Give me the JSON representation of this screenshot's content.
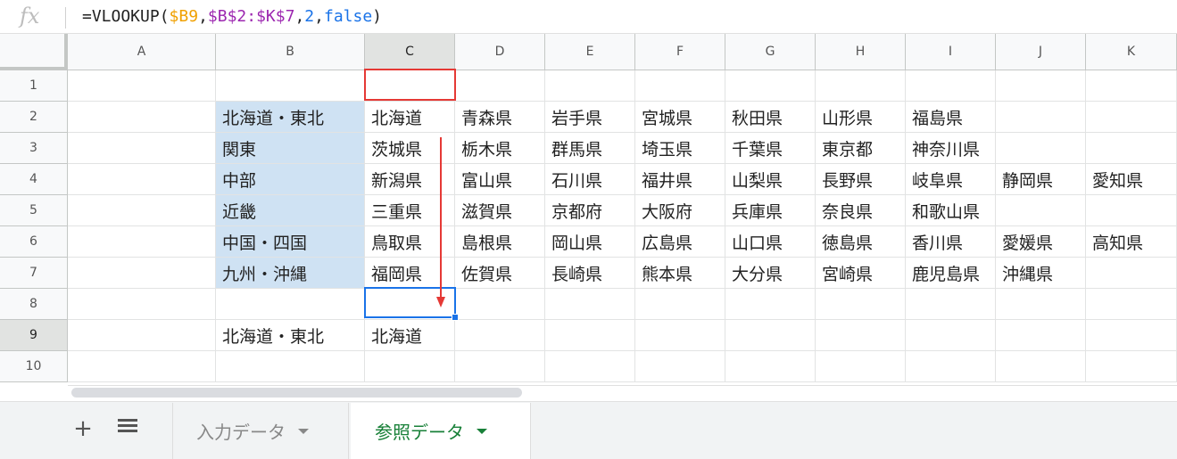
{
  "formula_bar": {
    "fx": "fx",
    "prefix": "=VLOOKUP(",
    "ref1": "$B9",
    "comma1": ",",
    "ref2": "$B$2:$K$7",
    "comma2": ",",
    "num": "2",
    "comma3": ",",
    "bool": "false",
    "suffix": ")"
  },
  "columns": [
    "A",
    "B",
    "C",
    "D",
    "E",
    "F",
    "G",
    "H",
    "I",
    "J",
    "K"
  ],
  "active_column": "C",
  "rows": [
    "1",
    "2",
    "3",
    "4",
    "5",
    "6",
    "7",
    "8",
    "9",
    "10"
  ],
  "active_row": "9",
  "cells": {
    "r2": [
      "",
      "北海道・東北",
      "北海道",
      "青森県",
      "岩手県",
      "宮城県",
      "秋田県",
      "山形県",
      "福島県",
      "",
      ""
    ],
    "r3": [
      "",
      "関東",
      "茨城県",
      "栃木県",
      "群馬県",
      "埼玉県",
      "千葉県",
      "東京都",
      "神奈川県",
      "",
      ""
    ],
    "r4": [
      "",
      "中部",
      "新潟県",
      "富山県",
      "石川県",
      "福井県",
      "山梨県",
      "長野県",
      "岐阜県",
      "静岡県",
      "愛知県"
    ],
    "r5": [
      "",
      "近畿",
      "三重県",
      "滋賀県",
      "京都府",
      "大阪府",
      "兵庫県",
      "奈良県",
      "和歌山県",
      "",
      ""
    ],
    "r6": [
      "",
      "中国・四国",
      "鳥取県",
      "島根県",
      "岡山県",
      "広島県",
      "山口県",
      "徳島県",
      "香川県",
      "愛媛県",
      "高知県"
    ],
    "r7": [
      "",
      "九州・沖縄",
      "福岡県",
      "佐賀県",
      "長崎県",
      "熊本県",
      "大分県",
      "宮崎県",
      "鹿児島県",
      "沖縄県",
      ""
    ],
    "r9": [
      "",
      "北海道・東北",
      "北海道",
      "",
      "",
      "",
      "",
      "",
      "",
      "",
      ""
    ]
  },
  "sheet_tabs": {
    "add_label": "+",
    "tabs": [
      {
        "label": "入力データ",
        "active": false
      },
      {
        "label": "参照データ",
        "active": true
      }
    ]
  },
  "colors": {
    "lookup_fill": "#cfe2f3",
    "highlight_border": "#e53935",
    "selection_border": "#1a73e8",
    "active_tab_text": "#188038"
  }
}
